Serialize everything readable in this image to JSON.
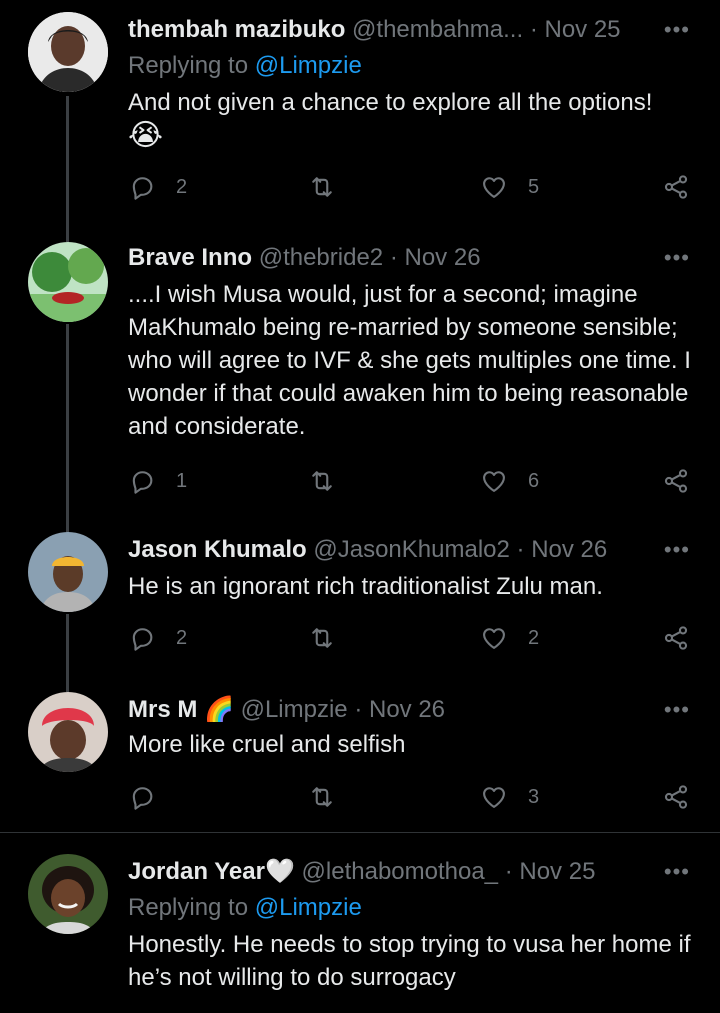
{
  "tweets": [
    {
      "name": "thembah mazibuko",
      "handle": "@thembahma...",
      "dot": "·",
      "date": "Nov 25",
      "replying_prefix": "Replying to",
      "replying_to": "@Limpzie",
      "text": "And not given a chance to explore all the options!",
      "emoji": "😭",
      "replies": "2",
      "retweets": "",
      "likes": "5"
    },
    {
      "name": "Brave Inno",
      "handle": "@thebride2",
      "dot": "·",
      "date": "Nov 26",
      "text": "....I wish Musa would, just for a second; imagine MaKhumalo being re-married by someone sensible; who will agree to IVF & she gets multiples one time. I wonder if that could awaken him to being reasonable and considerate.",
      "replies": "1",
      "retweets": "",
      "likes": "6"
    },
    {
      "name": "Jason Khumalo",
      "handle": "@JasonKhumalo2",
      "dot": "·",
      "date": "Nov 26",
      "text": "He is an ignorant rich traditionalist Zulu man.",
      "replies": "2",
      "retweets": "",
      "likes": "2"
    },
    {
      "name": "Mrs M",
      "name_emoji": "🌈",
      "handle": "@Limpzie",
      "dot": "·",
      "date": "Nov 26",
      "text": "More like cruel and selfish",
      "replies": "",
      "retweets": "",
      "likes": "3"
    },
    {
      "name": "Jordan Year",
      "name_emoji": "🤍",
      "handle": "@lethabomothoa_",
      "dot": "·",
      "date": "Nov 25",
      "replying_prefix": "Replying to",
      "replying_to": "@Limpzie",
      "text": "Honestly. He needs to stop trying to vusa her home if he’s not willing to do surrogacy"
    }
  ],
  "more_label": "•••",
  "icons": [
    "reply-icon",
    "retweet-icon",
    "like-icon",
    "share-icon",
    "more-icon"
  ],
  "colors": {
    "background": "#000000",
    "text": "#e7e9ea",
    "muted": "#71767b",
    "link": "#1d9bf0",
    "line": "#3b3f43"
  }
}
